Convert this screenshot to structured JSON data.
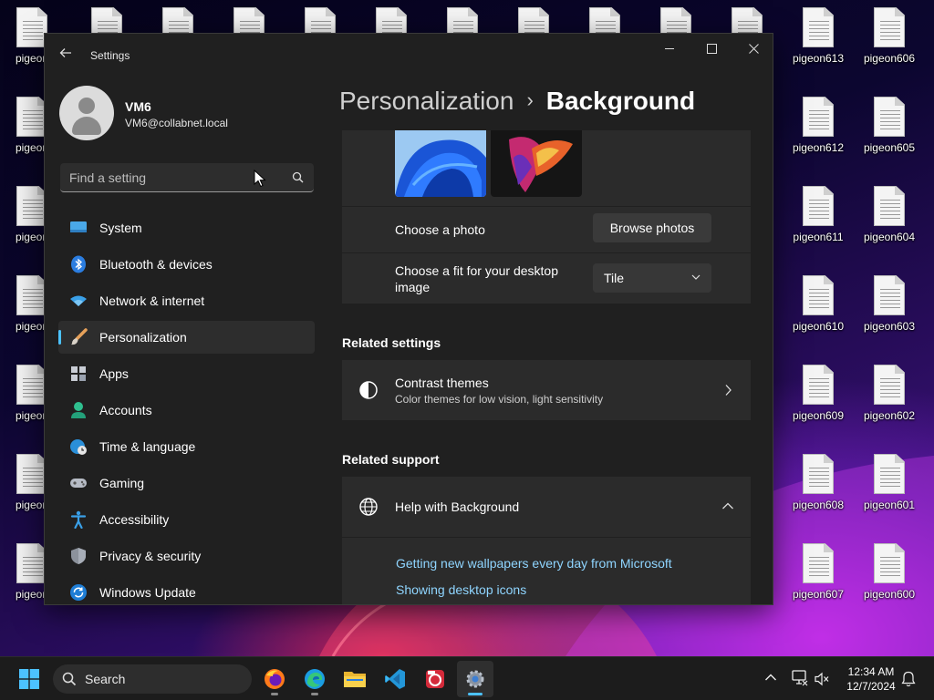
{
  "desktop": {
    "left_icons": [
      "pigeon",
      "pigeon",
      "pigeon",
      "pigeon",
      "pigeon",
      "pigeon",
      "pigeon"
    ],
    "right_column_1": [
      "pigeon613",
      "pigeon612",
      "pigeon611",
      "pigeon610",
      "pigeon609",
      "pigeon608",
      "pigeon607"
    ],
    "right_column_2": [
      "pigeon606",
      "pigeon605",
      "pigeon604",
      "pigeon603",
      "pigeon602",
      "pigeon601",
      "pigeon600"
    ]
  },
  "window": {
    "title": "Settings",
    "controls": {
      "minimize": "minimize-icon",
      "maximize": "maximize-icon",
      "close": "close-icon"
    }
  },
  "profile": {
    "name": "VM6",
    "email": "VM6@collabnet.local"
  },
  "search": {
    "placeholder": "Find a setting"
  },
  "sidebar": {
    "items": [
      {
        "label": "System",
        "icon": "monitor-icon",
        "active": false
      },
      {
        "label": "Bluetooth & devices",
        "icon": "bluetooth-icon",
        "active": false
      },
      {
        "label": "Network & internet",
        "icon": "wifi-icon",
        "active": false
      },
      {
        "label": "Personalization",
        "icon": "paintbrush-icon",
        "active": true
      },
      {
        "label": "Apps",
        "icon": "apps-icon",
        "active": false
      },
      {
        "label": "Accounts",
        "icon": "person-icon",
        "active": false
      },
      {
        "label": "Time & language",
        "icon": "globe-clock-icon",
        "active": false
      },
      {
        "label": "Gaming",
        "icon": "gamepad-icon",
        "active": false
      },
      {
        "label": "Accessibility",
        "icon": "accessibility-icon",
        "active": false
      },
      {
        "label": "Privacy & security",
        "icon": "shield-icon",
        "active": false
      },
      {
        "label": "Windows Update",
        "icon": "update-icon",
        "active": false
      }
    ]
  },
  "main": {
    "breadcrumb": {
      "parent": "Personalization",
      "separator": "›",
      "current": "Background"
    },
    "choose_photo": {
      "label": "Choose a photo",
      "button": "Browse photos"
    },
    "fit": {
      "label_line1": "Choose a fit for your desktop",
      "label_line2": "image",
      "value": "Tile"
    },
    "related_settings": {
      "title": "Related settings",
      "contrast_title": "Contrast themes",
      "contrast_subtitle": "Color themes for low vision, light sensitivity"
    },
    "related_support": {
      "title": "Related support",
      "help_title": "Help with Background",
      "links": [
        "Getting new wallpapers every day from Microsoft",
        "Showing desktop icons"
      ]
    }
  },
  "taskbar": {
    "search_label": "Search",
    "apps": [
      "start-icon",
      "firefox-icon",
      "edge-icon",
      "file-explorer-icon",
      "vscode-icon",
      "app-icon",
      "settings-icon"
    ],
    "time": "12:34 AM",
    "date": "12/7/2024"
  },
  "colors": {
    "accent": "#4cc2ff",
    "link": "#8fd5ff",
    "window_bg": "#202020",
    "card_bg": "#2b2b2b"
  }
}
